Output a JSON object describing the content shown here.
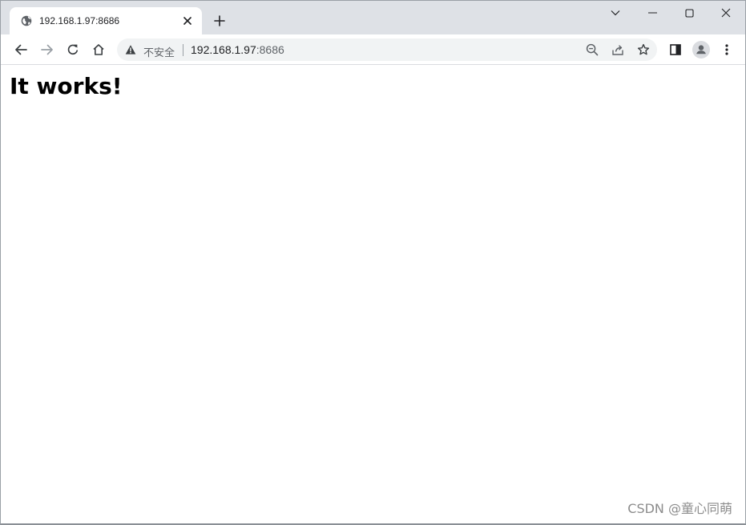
{
  "tab": {
    "title": "192.168.1.97:8686",
    "favicon": "globe-icon"
  },
  "omnibox": {
    "security_label": "不安全",
    "url_host": "192.168.1.97",
    "url_port": ":8686"
  },
  "page": {
    "heading": "It works!"
  },
  "watermark": "CSDN @童心同萌",
  "colors": {
    "tabstrip_bg": "#dee1e6",
    "omnibox_bg": "#f1f3f4",
    "icon": "#5f6368",
    "text": "#202124"
  }
}
